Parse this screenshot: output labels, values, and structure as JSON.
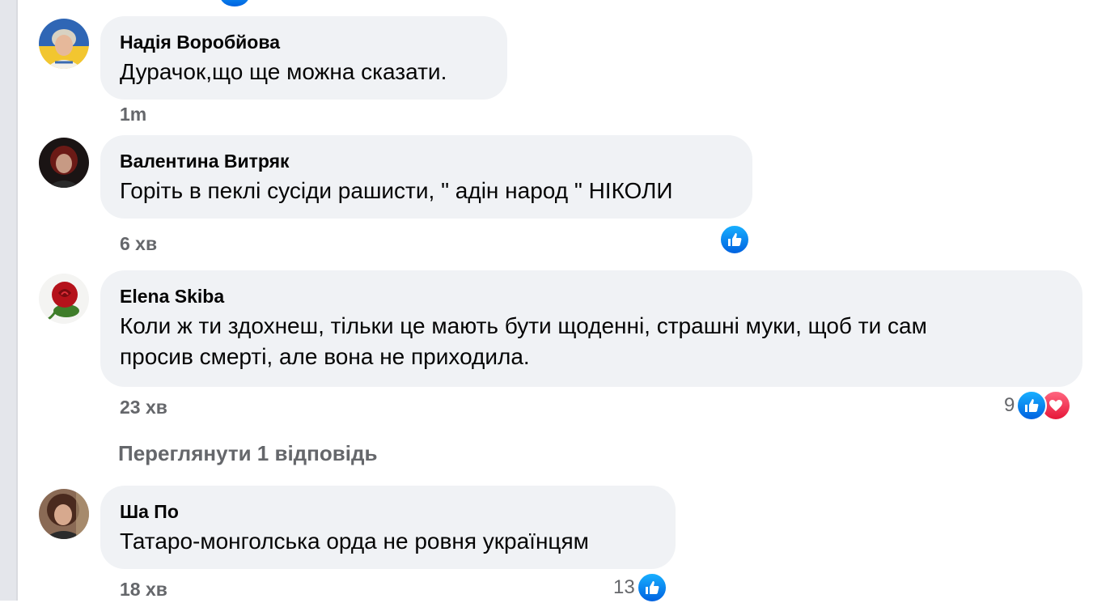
{
  "comments": [
    {
      "author": "Надія Воробйова",
      "text": "Дурачок,що ще можна сказати.",
      "time": "1m"
    },
    {
      "author": "Валентина Витряк",
      "text": "Горіть в пеклі сусіди рашисти, \" адін народ \" НІКОЛИ",
      "time": "6 хв"
    },
    {
      "author": "Elena Skiba",
      "text_line1": "Коли ж ти здохнеш, тільки це мають бути щоденні, страшні муки, щоб ти сам",
      "text_line2": "просив смерті, але вона не приходила.",
      "time": "23 хв",
      "reaction_count": "9"
    },
    {
      "author": "Ша По",
      "text": "Татаро-монголська орда не ровня українцям",
      "time": "18 хв",
      "reaction_count": "13"
    }
  ],
  "view_replies": "Переглянути 1 відповідь",
  "icons": {
    "like": "like-icon",
    "love": "love-icon"
  },
  "colors": {
    "bubble": "#f0f2f5",
    "meta_text": "#65676b",
    "like": "#0a7cff",
    "love": "#f33e58"
  }
}
